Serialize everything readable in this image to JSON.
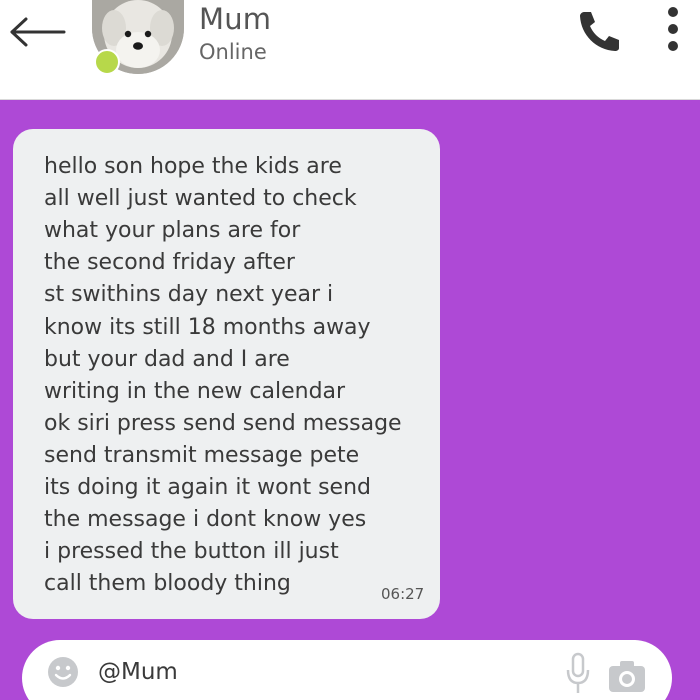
{
  "header": {
    "back_icon": "arrow-left-icon",
    "contact_name": "Mum",
    "status": "Online",
    "online_color": "#b7d84a",
    "call_icon": "phone-icon",
    "menu_icon": "more-vertical-icon"
  },
  "theme": {
    "chat_background": "#ae49d6",
    "bubble_background": "#eef0f1",
    "header_background": "#ffffff"
  },
  "message": {
    "lines": [
      "hello son hope the kids are",
      "all well just wanted to check",
      "what your plans are for",
      "the second friday after",
      "st swithins day next year i",
      "know its still 18 months away",
      "but your dad and I are",
      "writing in the new calendar",
      "ok siri press send send message",
      "send transmit message pete",
      "its doing it again it wont send",
      "the message i dont know yes",
      "i pressed the button ill just",
      "call them bloody thing"
    ],
    "time": "06:27"
  },
  "composer": {
    "emoji_icon": "emoji-icon",
    "value": "@Mum",
    "mic_icon": "microphone-icon",
    "camera_icon": "camera-icon"
  }
}
